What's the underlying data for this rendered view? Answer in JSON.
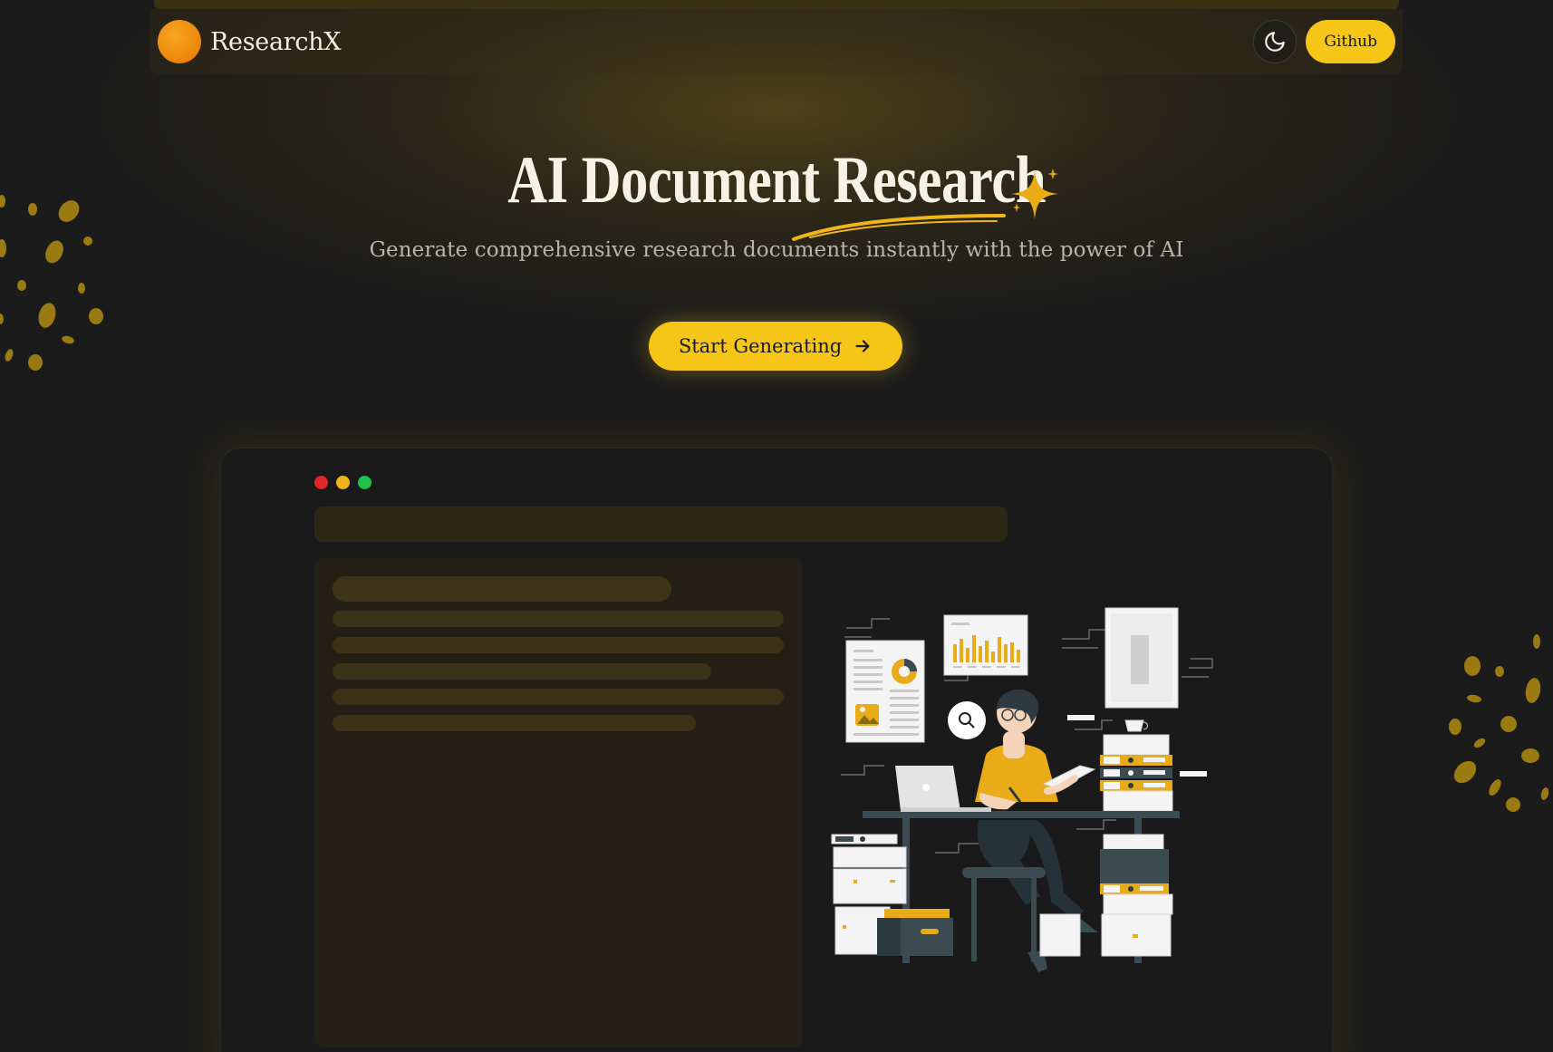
{
  "header": {
    "brand_name": "ResearchX",
    "theme_toggle_icon": "moon-icon",
    "github_label": "Github"
  },
  "hero": {
    "title_part1": "AI Document",
    "title_part2": "Research",
    "subtitle": "Generate comprehensive research documents instantly with the power of AI",
    "cta_label": "Start Generating",
    "cta_icon": "arrow-right-icon"
  },
  "colors": {
    "accent": "#f5c518",
    "background": "#1b1b1b",
    "logo": "#ee8a0c"
  }
}
